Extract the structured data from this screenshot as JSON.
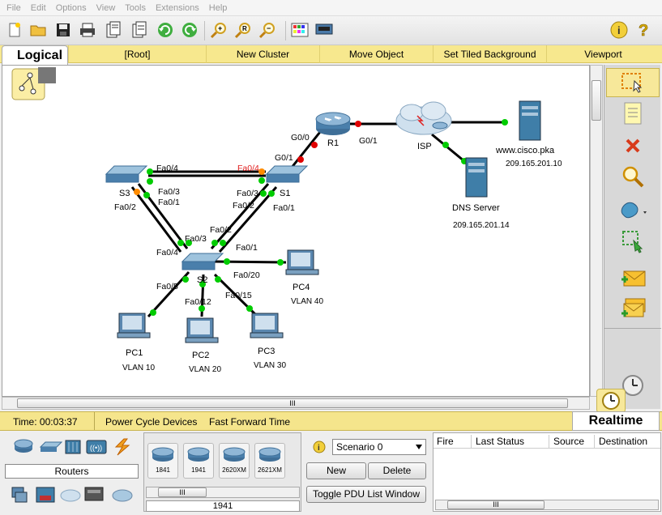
{
  "menu": [
    "File",
    "Edit",
    "Options",
    "View",
    "Tools",
    "Extensions",
    "Help"
  ],
  "workspace": {
    "logical_tab": "Logical",
    "bar_items": [
      "[Root]",
      "New Cluster",
      "Move Object",
      "Set Tiled Background",
      "Viewport"
    ]
  },
  "topology": {
    "devices": {
      "r1": "R1",
      "isp": "ISP",
      "www": "www.cisco.pka",
      "www_ip": "209.165.201.10",
      "dns": "DNS Server",
      "dns_ip": "209.165.201.14",
      "s1": "S1",
      "s2": "S2",
      "s3": "S3",
      "pc1": "PC1",
      "pc1_vlan": "VLAN 10",
      "pc2": "PC2",
      "pc2_vlan": "VLAN 20",
      "pc3": "PC3",
      "pc3_vlan": "VLAN 30",
      "pc4": "PC4",
      "pc4_vlan": "VLAN 40"
    },
    "ports": {
      "r1_g00": "G0/0",
      "r1_g01": "G0/1",
      "s1_g01": "G0/1",
      "s3_fa04": "Fa0/4",
      "s1_fa04": "Fa0/4",
      "s3_fa03": "Fa0/3",
      "s3_fa01": "Fa0/1",
      "s3_fa02": "Fa0/2",
      "s1_fa03": "Fa0/3",
      "s1_fa02": "Fa0/2",
      "s1_fa01": "Fa0/1",
      "s2_fa02": "Fa0/2",
      "s2_fa03": "Fa0/3",
      "s2_fa04": "Fa0/4",
      "s2_fa01": "Fa0/1",
      "s2_fa05": "Fa0/5",
      "s2_fa12": "Fa0/12",
      "s2_fa15": "Fa0/15",
      "s2_fa20": "Fa0/20"
    },
    "colors": {
      "link_up": "#00cc00",
      "link_down": "#e00000",
      "link_blocking": "#ff8c00"
    }
  },
  "scrollbar_glyph": "III",
  "status": {
    "time": "Time: 00:03:37",
    "power_cycle": "Power Cycle Devices",
    "fast_forward": "Fast Forward Time",
    "realtime_tab": "Realtime"
  },
  "device_panel": {
    "category_label": "Routers",
    "models": [
      "1841",
      "1941",
      "2620XM",
      "2621XM"
    ],
    "selected_model": "1941"
  },
  "scenario": {
    "selected": "Scenario 0",
    "new_label": "New",
    "delete_label": "Delete",
    "toggle_label": "Toggle PDU List Window"
  },
  "pdu_table": {
    "columns": [
      "Fire",
      "Last Status",
      "Source",
      "Destination"
    ]
  }
}
